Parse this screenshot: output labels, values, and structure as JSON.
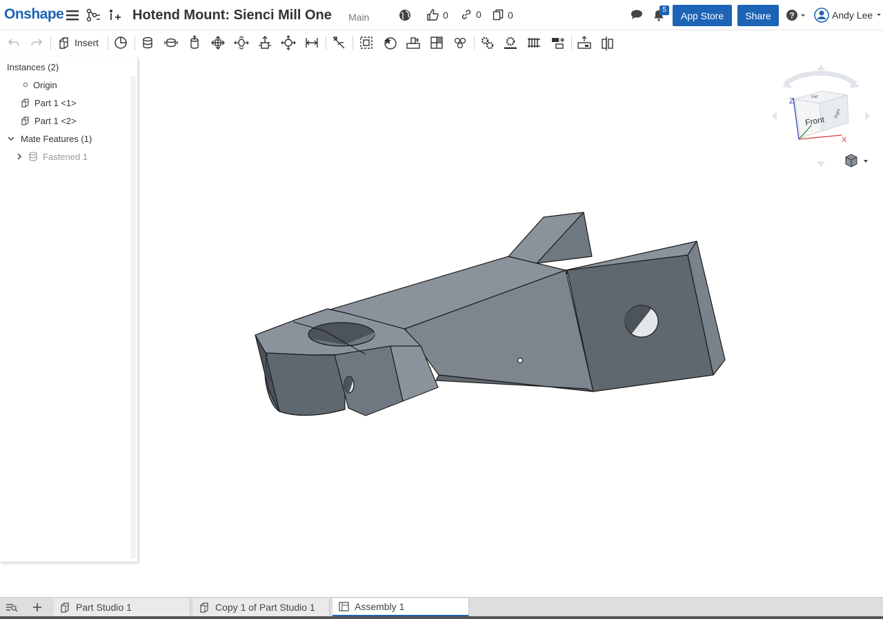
{
  "header": {
    "logo": "Onshape",
    "title": "Hotend Mount: Sienci Mill One",
    "branch": "Main",
    "likes": "0",
    "links": "0",
    "copies": "0",
    "notifications": "5",
    "app_store": "App Store",
    "share": "Share",
    "user": "Andy Lee"
  },
  "toolbar": {
    "insert_label": "Insert"
  },
  "panel": {
    "title": "Instances (2)",
    "items": [
      {
        "label": "Origin"
      },
      {
        "label": "Part 1 <1>"
      },
      {
        "label": "Part 1 <2>"
      },
      {
        "label": "Mate Features (1)"
      },
      {
        "label": "Fastened 1"
      }
    ]
  },
  "viewcube": {
    "face": "Front",
    "top_face": "Top",
    "right_face": "Right",
    "axis_z": "Z",
    "axis_x": "X"
  },
  "tabs": [
    {
      "label": "Part Studio 1"
    },
    {
      "label": "Copy 1 of Part Studio 1"
    },
    {
      "label": "Assembly 1"
    }
  ],
  "colors": {
    "accent": "#1d63b6",
    "part_light": "#8a939c",
    "part_mid": "#6f7880",
    "part_dark": "#555c63"
  }
}
